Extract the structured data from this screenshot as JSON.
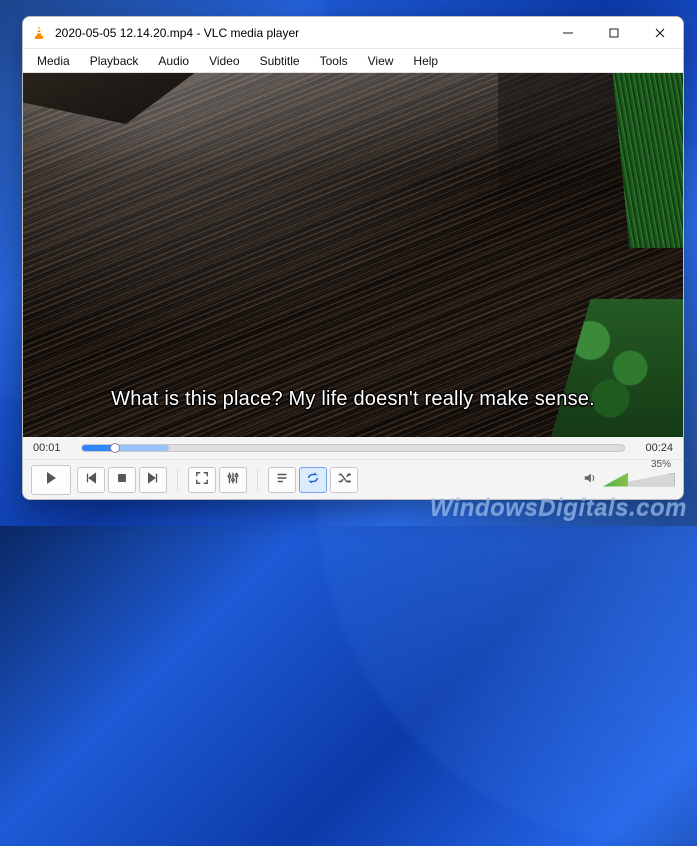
{
  "window": {
    "title": "2020-05-05 12.14.20.mp4 - VLC media player"
  },
  "menu": {
    "items": [
      "Media",
      "Playback",
      "Audio",
      "Video",
      "Subtitle",
      "Tools",
      "View",
      "Help"
    ]
  },
  "video": {
    "subtitle_text": "What is this place? My life doesn't really make sense."
  },
  "seek": {
    "elapsed": "00:01",
    "duration": "00:24",
    "progress_pct": 6,
    "buffer_pct": 16
  },
  "controls": {
    "play": "play-icon",
    "prev": "prev-icon",
    "stop": "stop-icon",
    "next": "next-icon",
    "fullscreen": "fullscreen-icon",
    "ext_settings": "equalizer-icon",
    "playlist": "playlist-icon",
    "loop": "loop-icon",
    "shuffle": "shuffle-icon",
    "loop_active": true
  },
  "volume": {
    "percent_label": "35%",
    "percent": 35
  },
  "watermark": "WindowsDigitals.com"
}
